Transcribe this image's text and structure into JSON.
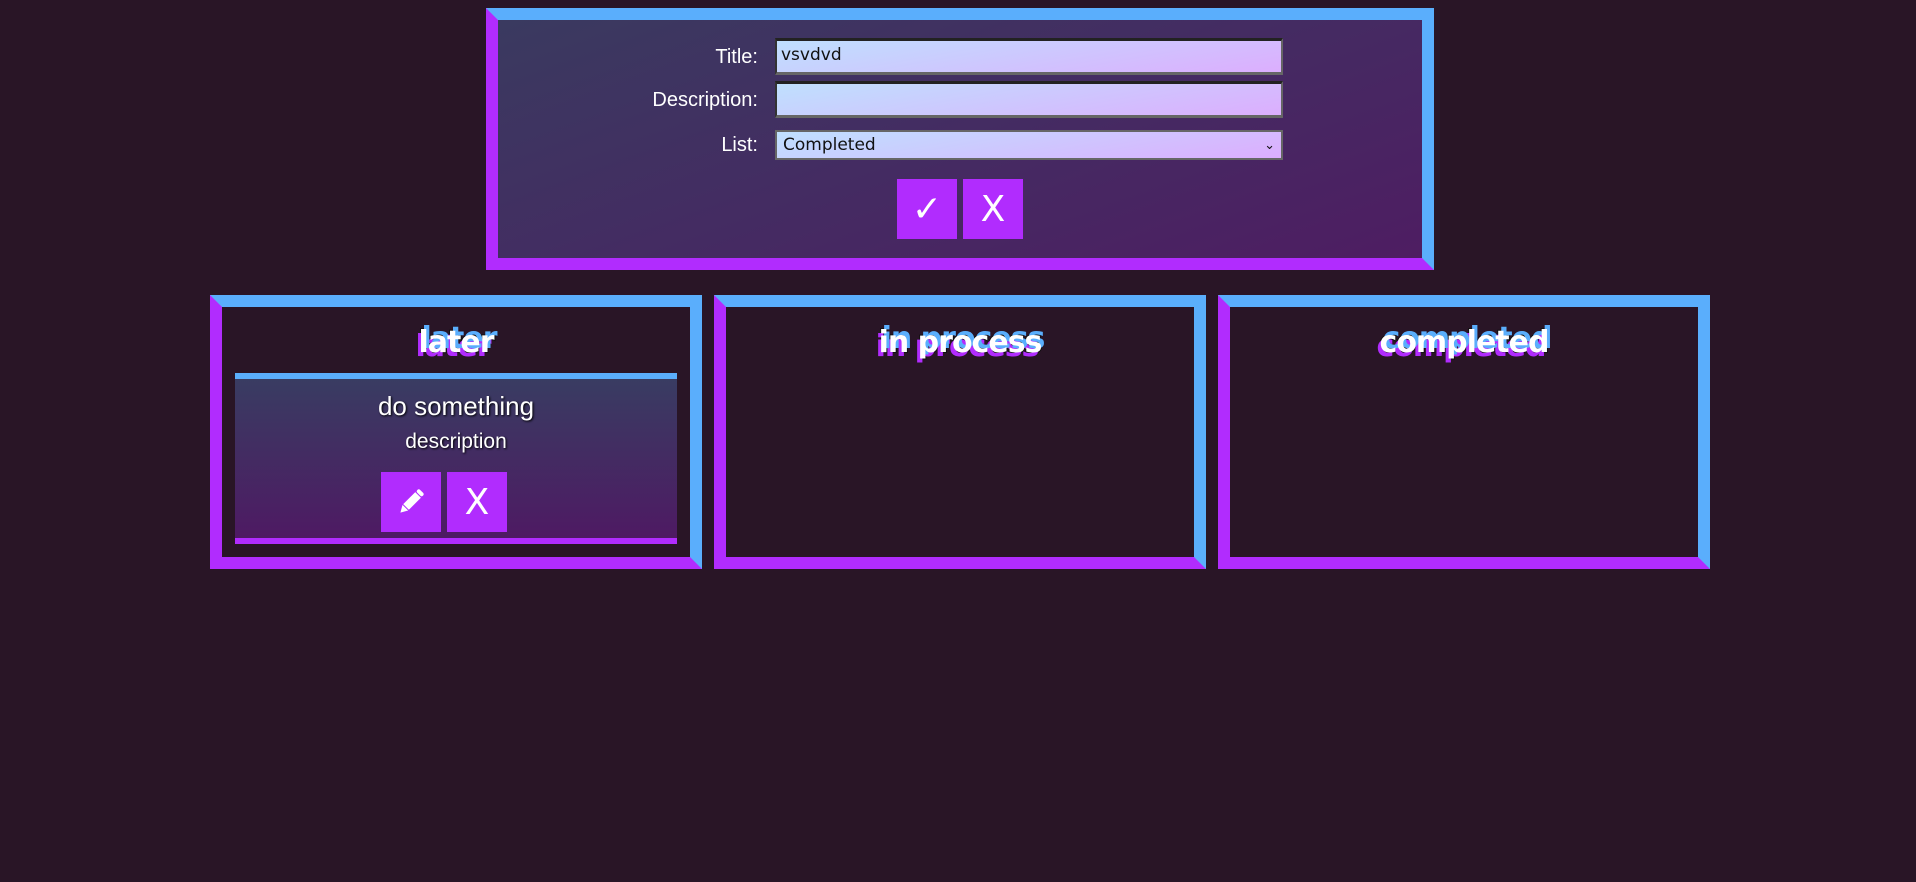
{
  "form": {
    "title_label": "Title:",
    "title_value": "vsvdvd",
    "description_label": "Description:",
    "description_value": "",
    "list_label": "List:",
    "list_selected": "Completed",
    "confirm_label": "✓",
    "cancel_label": "X"
  },
  "lists": [
    {
      "heading": "later",
      "cards": [
        {
          "title": "do something",
          "description": "description",
          "edit_icon": "pencil-icon",
          "delete_label": "X"
        }
      ]
    },
    {
      "heading": "in process",
      "cards": []
    },
    {
      "heading": "completed",
      "cards": []
    }
  ],
  "colors": {
    "accent_purple": "#b12cfe",
    "accent_blue": "#5aaefc",
    "background": "#291526"
  }
}
